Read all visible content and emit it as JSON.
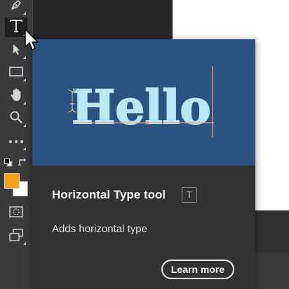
{
  "toolbar": {
    "tools": [
      {
        "name": "pen-tool",
        "icon": "pen-icon"
      },
      {
        "name": "horizontal-type-tool",
        "icon": "type-icon",
        "glyph": "T",
        "active": true
      },
      {
        "name": "path-selection-tool",
        "icon": "path-selection-icon"
      },
      {
        "name": "rectangle-tool",
        "icon": "rectangle-icon"
      },
      {
        "name": "hand-tool",
        "icon": "hand-icon"
      },
      {
        "name": "zoom-tool",
        "icon": "zoom-icon"
      },
      {
        "name": "edit-toolbar",
        "icon": "more-icon"
      },
      {
        "name": "quick-mask",
        "icon": "quick-mask-icon"
      },
      {
        "name": "screen-mode",
        "icon": "screen-mode-icon"
      }
    ],
    "foreground_color": "#f7a21b",
    "background_color": "#ffffff"
  },
  "tooltip": {
    "preview_word": "Hello",
    "preview_bg": "#2b5280",
    "preview_text_color": "#b9e8f5",
    "title": "Horizontal Type tool",
    "shortcut": "T",
    "description": "Adds horizontal type",
    "learn_more": "Learn more"
  }
}
